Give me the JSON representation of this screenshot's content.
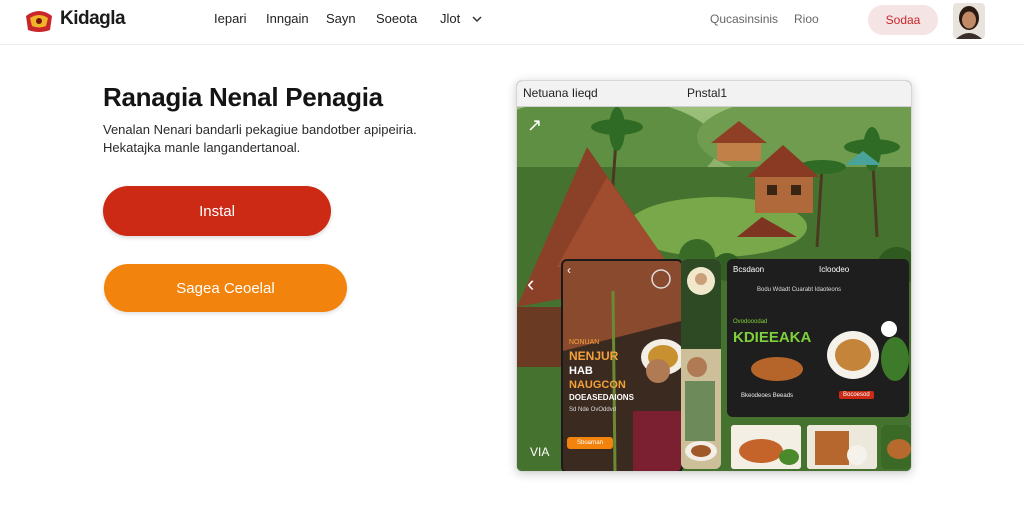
{
  "header": {
    "brand": "Kidagla",
    "nav": [
      "Iepari",
      "Inngain",
      "Sayn",
      "Soeota",
      "Jlot"
    ],
    "links": [
      "Qucasinsinis",
      "Rioo"
    ],
    "signin_label": "Sodaa"
  },
  "hero": {
    "title": "Ranagia Nenal Penagia",
    "description_lines": [
      "Venalan Nenari bandarli pekagiue bandotber apipeiria.",
      "Hekatajka manle langandertanoal."
    ],
    "primary_button": "Instal",
    "secondary_button": "Sagea Ceoelal"
  },
  "preview": {
    "tabs": [
      "Netuana Iieqd",
      "Pnstal1"
    ],
    "corner_label": "VIA",
    "panel_a": {
      "lines": [
        "NONUAN",
        "NENJUR",
        "HAB",
        "NAUGCON",
        "DOEASEDAIONS",
        "Sd Nde OvOddvd"
      ],
      "button": "Sboarnan"
    },
    "panel_c": {
      "header_left": "Bcsdaon",
      "header_right": "Icloodeo",
      "subtitle": "Bodu Wdadt Cuarabt Idaoteons",
      "tag": "Ovodooodad",
      "title": "KDIEEAKA",
      "footer_left": "Bkeodeoes Beeads",
      "footer_right": "Bocoesod"
    }
  },
  "colors": {
    "primary": "#cc2a14",
    "secondary": "#f2830c",
    "signin_bg": "#f5e4e4",
    "signin_text": "#c8262b",
    "green_accent": "#7fd13b"
  }
}
